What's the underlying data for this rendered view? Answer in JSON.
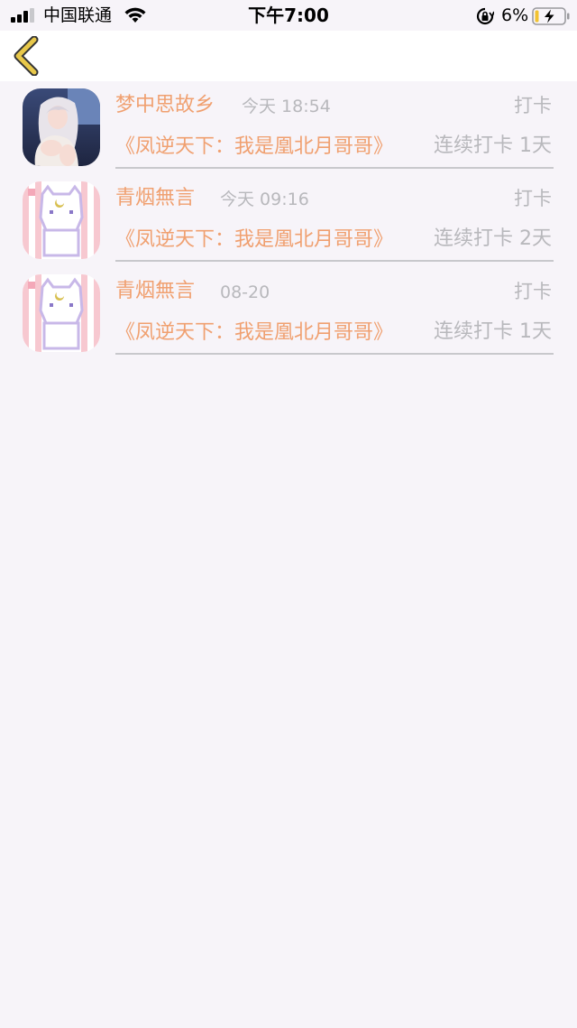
{
  "status_bar": {
    "carrier": "中国联通",
    "time": "下午7:00",
    "battery": "6%"
  },
  "nav": {
    "back_icon": "chevron-left-icon",
    "accent_color": "#e8c84a"
  },
  "colors": {
    "name": "#f0a070",
    "muted": "#b8b8bc",
    "background": "#f7f4f9"
  },
  "items": [
    {
      "avatar": "anime-girl-avatar",
      "name": "梦中思故乡",
      "time": "今天 18:54",
      "tag": "打卡",
      "book": "《凤逆天下：我是凰北月哥哥》",
      "streak": "连续打卡 1天"
    },
    {
      "avatar": "pixel-cat-avatar",
      "name": "青烟無言",
      "time": "今天 09:16",
      "tag": "打卡",
      "book": "《凤逆天下：我是凰北月哥哥》",
      "streak": "连续打卡 2天"
    },
    {
      "avatar": "pixel-cat-avatar",
      "name": "青烟無言",
      "time": "08-20",
      "tag": "打卡",
      "book": "《凤逆天下：我是凰北月哥哥》",
      "streak": "连续打卡 1天"
    }
  ]
}
